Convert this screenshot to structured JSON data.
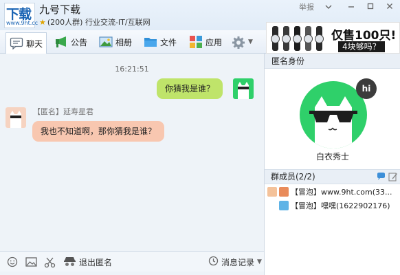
{
  "logo": {
    "main": "下载",
    "sub": "www.9ht.cc"
  },
  "group": {
    "name": "九号下载",
    "meta": "(200人群) 行业交流-IT/互联网"
  },
  "window": {
    "report": "举报",
    "menu_icon": "chevron-down-icon",
    "minimize_icon": "minimize-icon",
    "maximize_icon": "maximize-icon",
    "close_icon": "close-icon"
  },
  "tabs": [
    {
      "label": "聊天",
      "icon": "chat-icon",
      "active": true
    },
    {
      "label": "公告",
      "icon": "megaphone-icon"
    },
    {
      "label": "相册",
      "icon": "photo-icon"
    },
    {
      "label": "文件",
      "icon": "folder-icon"
    },
    {
      "label": "应用",
      "icon": "apps-icon"
    }
  ],
  "ad": {
    "headline": "仅售100只!",
    "tagline": "4块够吗？"
  },
  "chat": {
    "timestamp": "16:21:51",
    "messages": [
      {
        "from": "me",
        "text": "你猜我是谁？"
      },
      {
        "from": "other",
        "sender": "【匿名】延寿星君",
        "text": "我也不知道啊，那你猜我是谁？"
      }
    ]
  },
  "input_toolbar": {
    "exit_anon": "退出匿名",
    "history": "消息记录"
  },
  "anon_panel": {
    "header": "匿名身份",
    "bubble": "hi",
    "name": "白衣秀士"
  },
  "members": {
    "header": "群成员(2/2)",
    "list": [
      {
        "tag": "【冒泡】",
        "text": "www.9ht.com(33..."
      },
      {
        "tag": "【冒泡】",
        "text": "嘿嘿(1622902176)"
      }
    ]
  },
  "colors": {
    "my_bubble": "#bfe46a",
    "other_bubble": "#f8c7b0",
    "anon_avatar": "#2fd06a",
    "logo_blue": "#1a64b4"
  }
}
